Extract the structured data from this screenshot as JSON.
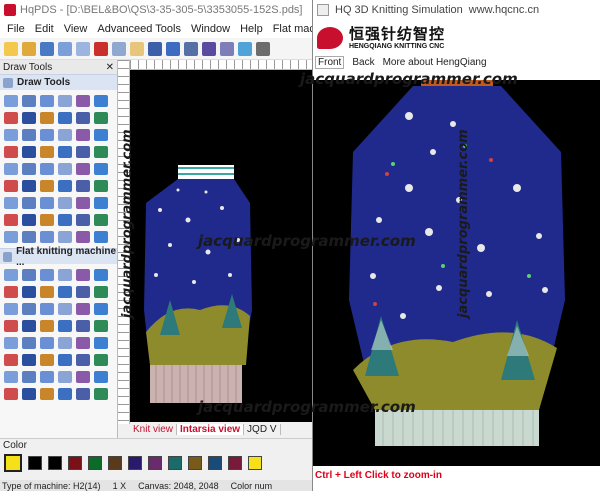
{
  "main_window": {
    "title": "HqPDS - [D:\\BEL&BO\\QS\\3-35-305-5\\3353055-152S.pds]",
    "menu": [
      "File",
      "Edit",
      "View",
      "Advanceed Tools",
      "Window",
      "Help",
      "Flat machine"
    ]
  },
  "draw_tools_panel": {
    "title": "Draw Tools",
    "section1": "Draw Tools",
    "section2": "Flat knitting machine ..."
  },
  "tabs": [
    "Knit view",
    "Intarsia view",
    "JQD V"
  ],
  "color_bar": {
    "label": "Color"
  },
  "status": {
    "machine": "Type of machine: H2(14)",
    "zoom": "1 X",
    "canvas": "Canvas: 2048, 2048",
    "color_num": "Color num"
  },
  "sim_window": {
    "title": "HQ 3D Knitting Simulation",
    "url": "www.hqcnc.cn",
    "logo_cn": "恒强针纺智控",
    "logo_en": "HENGQIANG KNITTING CNC",
    "nav": [
      "Front",
      "Back",
      "More about HengQiang"
    ],
    "hint": "Ctrl + Left Click to zoom-in"
  },
  "watermark": "jacquardprogrammer.com",
  "colors": {
    "navy": "#1f2a8c",
    "olive": "#8d8b2b",
    "tree": "#2e7a7a",
    "hem": "#c9b2b0",
    "accent_red": "#c8102e"
  }
}
